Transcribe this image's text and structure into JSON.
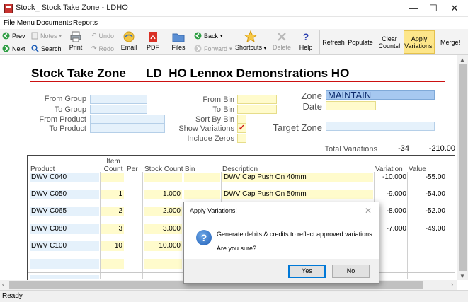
{
  "window": {
    "title": "Stock_ Stock Take Zone - LDHO",
    "minimize_glyph": "—",
    "maximize_glyph": "☐",
    "close_glyph": "✕"
  },
  "menu": [
    "File Menu",
    "Documents",
    "Reports"
  ],
  "toolbar": {
    "prev": "Prev",
    "next": "Next",
    "notes": "Notes",
    "search": "Search",
    "undo": "Undo",
    "redo": "Redo",
    "print": "Print",
    "email": "Email",
    "pdf": "PDF",
    "files": "Files",
    "back": "Back",
    "forward": "Forward",
    "shortcuts": "Shortcuts",
    "delete": "Delete",
    "help": "Help",
    "refresh": "Refresh",
    "populate": "Populate",
    "clear_counts": [
      "Clear",
      "Counts!"
    ],
    "apply_variations": [
      "Apply",
      "Variations!"
    ],
    "merge": "Merge!"
  },
  "form": {
    "heading": "Stock Take Zone      LD  HO Lennox Demonstrations HO",
    "from_group": "From Group",
    "to_group": "To Group",
    "from_product": "From Product",
    "to_product": "To Product",
    "from_bin": "From Bin",
    "to_bin": "To Bin",
    "sort_by_bin": "Sort By Bin",
    "show_variations": "Show Variations",
    "include_zeros": "Include Zeros",
    "show_variations_check": "✓",
    "zone_label": "Zone",
    "zone_value": "MAINTAIN",
    "date_label": "Date",
    "target_zone_label": "Target Zone",
    "total_variations_label": "Total Variations",
    "total_variations_qty": "-34",
    "total_variations_value": "-210.00"
  },
  "grid": {
    "headers": {
      "product": "Product",
      "item_count": [
        "Item",
        "Count"
      ],
      "per": "Per",
      "stock_count": "Stock Count",
      "bin": "Bin",
      "description": "Description",
      "variation": "Variation",
      "value": "Value"
    },
    "rows": [
      {
        "product": "DWV C040",
        "count": "",
        "stock": "",
        "description": "DWV Cap Push On 40mm",
        "variation": "-10.000",
        "value": "-55.00"
      },
      {
        "product": "DWV C050",
        "count": "1",
        "stock": "1.000",
        "description": "DWV Cap Push On 50mm",
        "variation": "-9.000",
        "value": "-54.00"
      },
      {
        "product": "DWV C065",
        "count": "2",
        "stock": "2.000",
        "description": "",
        "variation": "-8.000",
        "value": "-52.00"
      },
      {
        "product": "DWV C080",
        "count": "3",
        "stock": "3.000",
        "description": "",
        "variation": "-7.000",
        "value": "-49.00"
      },
      {
        "product": "DWV C100",
        "count": "10",
        "stock": "10.000",
        "description": "",
        "variation": "",
        "value": ""
      }
    ]
  },
  "status": "Ready",
  "dialog": {
    "title": "Apply Variations!",
    "icon": "?",
    "close": "✕",
    "message": "Generate debits & credits to reflect approved variations",
    "question": "Are you sure?",
    "yes": "Yes",
    "no": "No"
  },
  "colors": {
    "accent_red": "#cc1111",
    "field_blue": "#e5f1fb",
    "field_yellow": "#fffbcc",
    "zone_highlight": "#a6c8f0",
    "active_button": "#fde68a"
  }
}
